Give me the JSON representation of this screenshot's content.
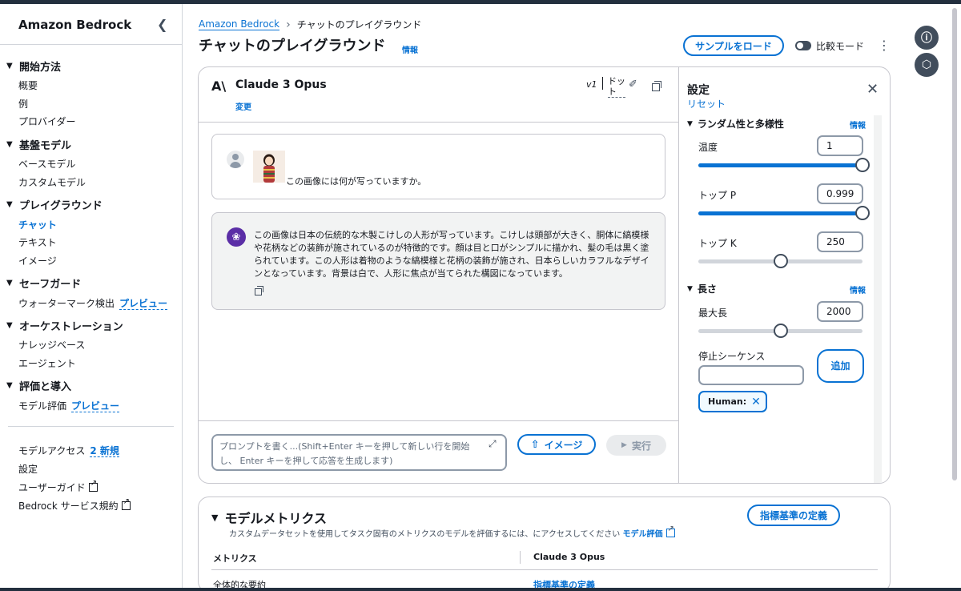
{
  "sidebar": {
    "title": "Amazon Bedrock",
    "sections": [
      {
        "label": "開始方法",
        "items": [
          "概要",
          "例",
          "プロバイダー"
        ]
      },
      {
        "label": "基盤モデル",
        "items": [
          "ベースモデル",
          "カスタムモデル"
        ]
      },
      {
        "label": "プレイグラウンド",
        "items": [
          "チャット",
          "テキスト",
          "イメージ"
        ]
      },
      {
        "label": "セーフガード",
        "items": [
          "ウォーターマーク検出"
        ]
      },
      {
        "label": "オーケストレーション",
        "items": [
          "ナレッジベース",
          "エージェント"
        ]
      },
      {
        "label": "評価と導入",
        "items": [
          "モデル評価"
        ]
      }
    ],
    "preview_label": "プレビュー",
    "bottom": {
      "model_access": "モデルアクセス",
      "model_access_badge": "2 新規",
      "settings": "設定",
      "user_guide": "ユーザーガイド",
      "service_terms": "Bedrock サービス規約"
    }
  },
  "header": {
    "breadcrumb_root": "Amazon Bedrock",
    "breadcrumb_current": "チャットのプレイグラウンド",
    "title": "チャットのプレイグラウンド",
    "info": "情報",
    "load_sample": "サンプルをロード",
    "compare_mode": "比較モード"
  },
  "model": {
    "name": "Claude 3 Opus",
    "change": "変更",
    "version": "v1",
    "dot_label": "ドット"
  },
  "chat": {
    "user_message": "この画像には何が写っていますか。",
    "ai_message": "この画像は日本の伝統的な木製こけしの人形が写っています。こけしは頭部が大きく、胴体に縞模様や花柄などの装飾が施されているのが特徴的です。顔は目と口がシンプルに描かれ、髪の毛は黒く塗られています。この人形は着物のような縞模様と花柄の装飾が施され、日本らしいカラフルなデザインとなっています。背景は白で、人形に焦点が当てられた構図になっています。",
    "prompt_placeholder": "プロンプトを書く...(Shift+Enter キーを押して新しい行を開始し、 Enter キーを押して応答を生成します)",
    "image_button": "イメージ",
    "run_button": "実行"
  },
  "settings": {
    "title": "設定",
    "reset": "リセット",
    "sections": {
      "randomness": "ランダム性と多様性",
      "length": "長さ",
      "info": "情報"
    },
    "params": {
      "temperature": {
        "label": "温度",
        "value": "1",
        "fraction": 1.0
      },
      "top_p": {
        "label": "トップ P",
        "value": "0.999",
        "fraction": 1.0
      },
      "top_k": {
        "label": "トップ K",
        "value": "250",
        "fraction": 0.5
      },
      "max_length": {
        "label": "最大長",
        "value": "2000",
        "fraction": 0.5
      }
    },
    "stop_sequences_label": "停止シーケンス",
    "add_button": "追加",
    "token": "Human:"
  },
  "metrics": {
    "title": "モデルメトリクス",
    "description": "カスタムデータセットを使用してタスク固有のメトリクスのモデルを評価するには、にアクセスしてください",
    "description_link": "モデル評価",
    "define_button": "指標基準の定義",
    "col_metrics": "メトリクス",
    "col_model": "Claude 3 Opus",
    "row_label": "全体的な要約",
    "row_link": "指標基準の定義"
  },
  "colors": {
    "accent": "#0972d3",
    "nav_dark": "#232f3e",
    "ai_avatar": "#5b2ea6"
  }
}
